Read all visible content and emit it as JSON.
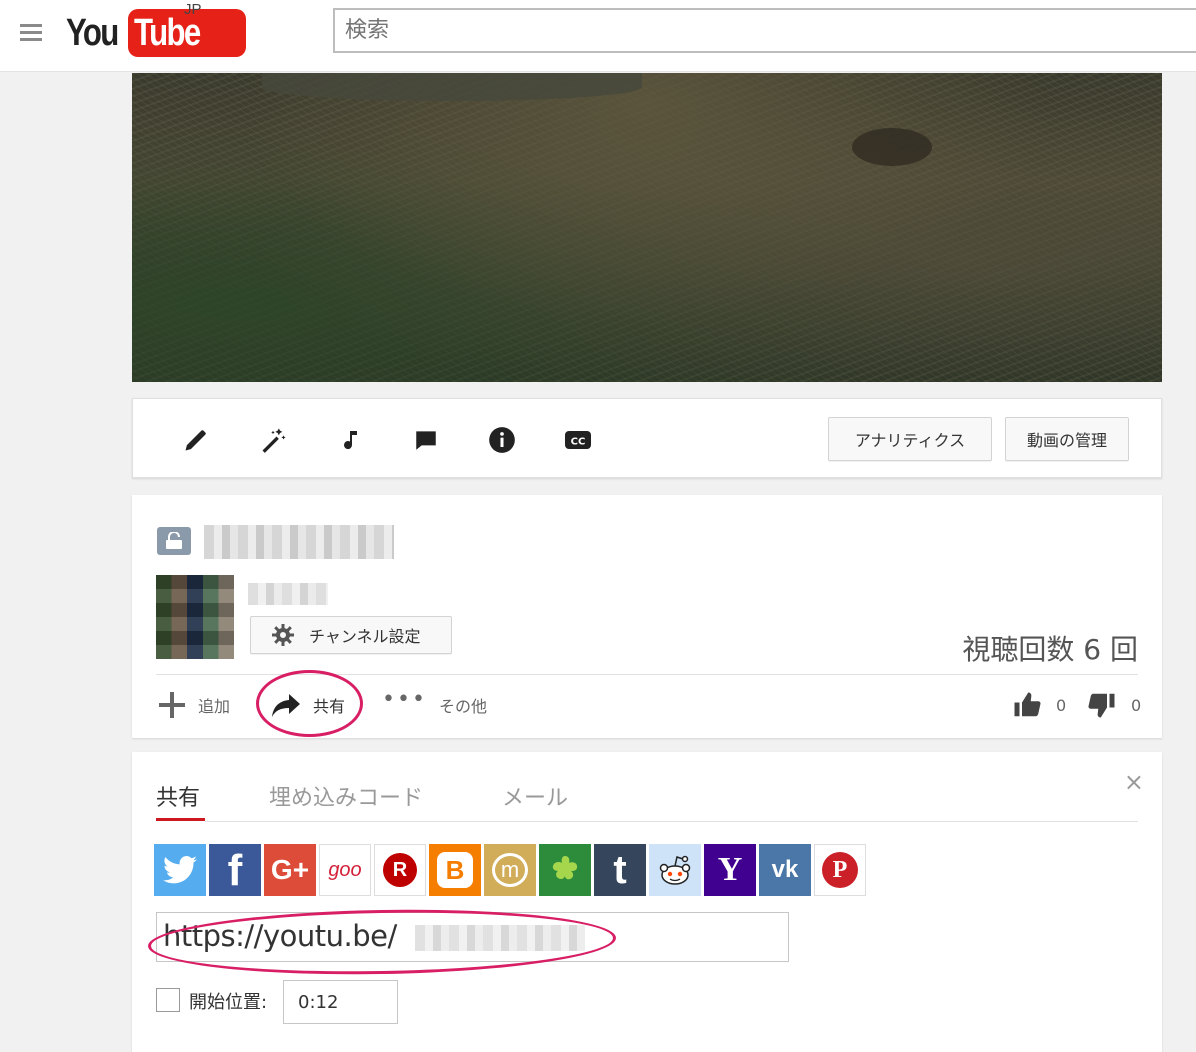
{
  "header": {
    "logo_you": "You",
    "logo_tube": "Tube",
    "country": "JP",
    "search_placeholder": "検索"
  },
  "toolbar": {
    "analytics_label": "アナリティクス",
    "manage_label": "動画の管理",
    "icons": [
      "edit-icon",
      "enhance-icon",
      "audio-icon",
      "annotations-icon",
      "info-icon",
      "captions-icon"
    ]
  },
  "info": {
    "channel_settings_label": "チャンネル設定",
    "views_text": "視聴回数 6 回",
    "add_label": "追加",
    "share_label": "共有",
    "more_label": "その他",
    "likes": "0",
    "dislikes": "0"
  },
  "share_panel": {
    "tabs": [
      "共有",
      "埋め込みコード",
      "メール"
    ],
    "close_label": "×",
    "url_prefix": "https://youtu.be/",
    "start_label": "開始位置:",
    "start_time": "0:12",
    "social": [
      {
        "name": "twitter",
        "glyph": "",
        "color": "#55acee"
      },
      {
        "name": "facebook",
        "glyph": "f",
        "color": "#3b5998"
      },
      {
        "name": "google-plus",
        "glyph": "G+",
        "color": "#dd4b39"
      },
      {
        "name": "goo",
        "glyph": "goo",
        "color": "#ffffff"
      },
      {
        "name": "rakuten",
        "glyph": "R",
        "color": "#ffffff"
      },
      {
        "name": "blogger",
        "glyph": "B",
        "color": "#f57d00"
      },
      {
        "name": "mixi",
        "glyph": "m",
        "color": "#d1ad59"
      },
      {
        "name": "ameba",
        "glyph": "",
        "color": "#2d8c3c"
      },
      {
        "name": "tumblr",
        "glyph": "t",
        "color": "#35465c"
      },
      {
        "name": "reddit",
        "glyph": "",
        "color": "#cee3f8"
      },
      {
        "name": "yahoo",
        "glyph": "Y",
        "color": "#400191"
      },
      {
        "name": "vk",
        "glyph": "vk",
        "color": "#4a76a8"
      },
      {
        "name": "pinterest",
        "glyph": "P",
        "color": "#ffffff"
      }
    ]
  },
  "colors": {
    "brand_red": "#e62117",
    "highlight_circle": "#d81e64",
    "active_tab_underline": "#cc181e"
  }
}
